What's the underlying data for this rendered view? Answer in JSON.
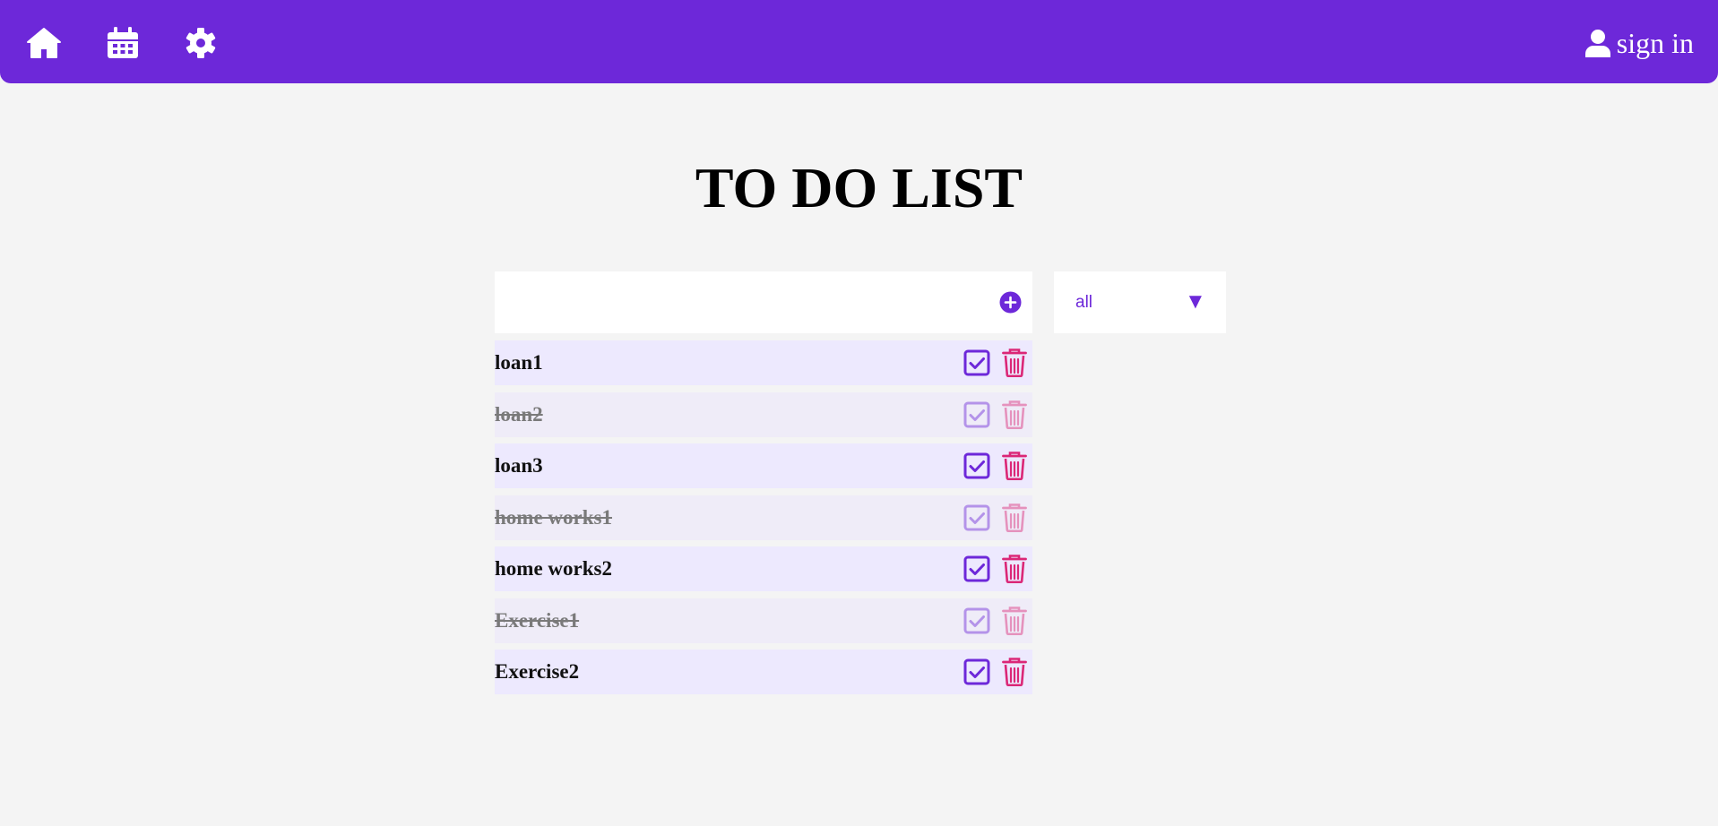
{
  "nav": {
    "icons": [
      "home-icon",
      "calendar-icon",
      "gear-icon"
    ],
    "signin_label": "sign in",
    "signin_icon": "user-icon",
    "color": "#6d28d9"
  },
  "page": {
    "title": "TO DO LIST"
  },
  "add_form": {
    "input_value": "",
    "button_icon": "plus-circle-icon"
  },
  "filter": {
    "selected": "all",
    "arrow": "▼"
  },
  "todos": [
    {
      "text": "loan1",
      "completed": false
    },
    {
      "text": "loan2",
      "completed": true
    },
    {
      "text": "loan3",
      "completed": false
    },
    {
      "text": "home works1",
      "completed": true
    },
    {
      "text": "home works2",
      "completed": false
    },
    {
      "text": "Exercise1",
      "completed": true
    },
    {
      "text": "Exercise2",
      "completed": false
    }
  ],
  "colors": {
    "accent": "#6d28d9",
    "danger": "#db2777",
    "row_bg": "#ede9fe",
    "page_bg": "#f4f4f4"
  }
}
